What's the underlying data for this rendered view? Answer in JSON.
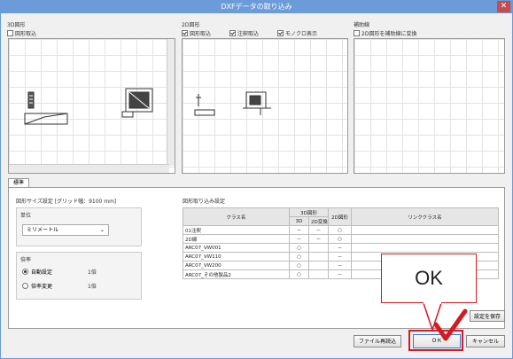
{
  "window": {
    "title": "DXFデータの取り込み",
    "close": "✕"
  },
  "sections": {
    "three_d": {
      "label": "3D図形",
      "checkbox": "図形取込"
    },
    "two_d": {
      "label": "2D図形",
      "checkboxes": [
        "図形取込",
        "注釈取込",
        "モノクロ表示"
      ]
    },
    "aux": {
      "label": "補助線",
      "checkbox": "2D図形を補助線に変換"
    }
  },
  "tab": "標準",
  "size_settings": {
    "title": "図形サイズ設定 [グリッド幅：9100 mm]",
    "unit_label": "単位",
    "unit_value": "ミリメートル",
    "scale_label": "倍率",
    "auto_option": "自動設定",
    "auto_value": "1倍",
    "change_option": "倍率変更",
    "change_value": "1倍"
  },
  "import_settings": {
    "title": "図形取り込み設定",
    "headers": {
      "class": "クラス名",
      "group3d": "3D図形",
      "sub3d": "3D",
      "sub2d": "2D変換",
      "fig2d": "2D図形",
      "link": "リンククラス名"
    },
    "rows": [
      {
        "name": "01注釈",
        "c3d": "－",
        "c2d": "－",
        "fig": "○",
        "link": ""
      },
      {
        "name": "2D線",
        "c3d": "－",
        "c2d": "－",
        "fig": "○",
        "link": ""
      },
      {
        "name": "ARC07_VW001",
        "c3d": "○",
        "c2d": "",
        "fig": "－",
        "link": ""
      },
      {
        "name": "ARC07_VW110",
        "c3d": "○",
        "c2d": "",
        "fig": "－",
        "link": ""
      },
      {
        "name": "ARC07_VW200",
        "c3d": "○",
        "c2d": "",
        "fig": "－",
        "link": ""
      },
      {
        "name": "ARC07_その他製品2",
        "c3d": "○",
        "c2d": "",
        "fig": "－",
        "link": ""
      }
    ]
  },
  "buttons": {
    "save": "設定を保存",
    "reload": "ファイル再読込",
    "ok": "ＯＫ",
    "cancel": "キャンセル"
  },
  "annotation": {
    "callout": "OK",
    "accent": "#d51a22"
  }
}
